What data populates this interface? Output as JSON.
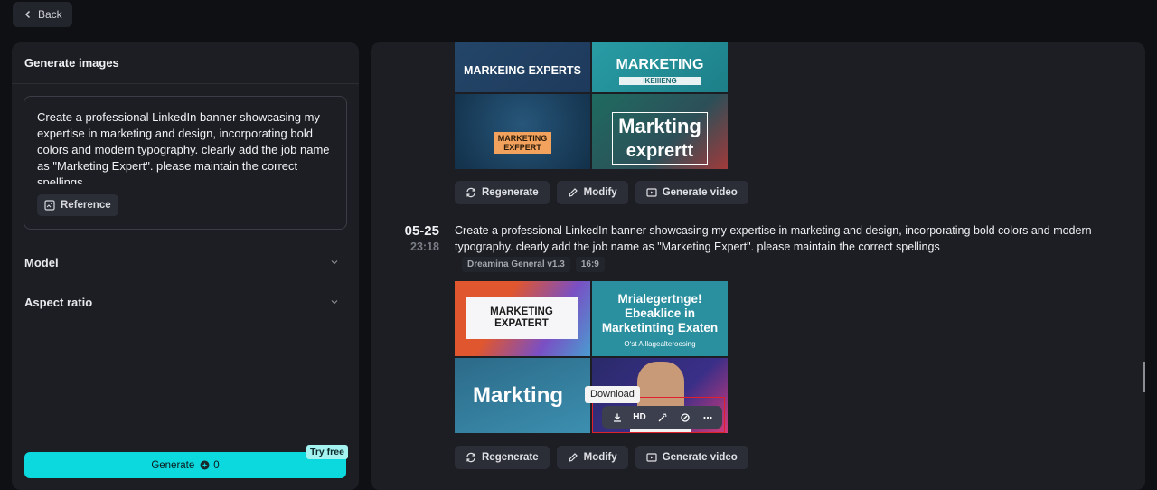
{
  "back": {
    "label": "Back"
  },
  "left": {
    "title": "Generate images",
    "prompt": "Create a professional LinkedIn banner showcasing my expertise in marketing and design, incorporating bold colors and modern typography. clearly add the job name as \"Marketing Expert\". please maintain the correct spellings",
    "reference_label": "Reference",
    "settings": [
      {
        "label": "Model",
        "icon": "chevron-down-icon"
      },
      {
        "label": "Aspect ratio",
        "icon": "chevron-down-icon"
      }
    ],
    "generate_label": "Generate",
    "credit_count": "0",
    "try_free_label": "Try free",
    "accent_color": "#0bd9de"
  },
  "feed": {
    "top_group": {
      "images": [
        {
          "lines": [
            "MARKEING EXPERTS"
          ]
        },
        {
          "lines": [
            "MARKETING",
            "IKEIIIENG"
          ]
        },
        {
          "lines": [
            "MARKETING",
            "EXFPERT"
          ]
        },
        {
          "lines": [
            "Markting",
            "exprertt"
          ]
        }
      ],
      "actions": [
        "Regenerate",
        "Modify",
        "Generate video"
      ]
    },
    "entry": {
      "date": "05-25",
      "time": "23:18",
      "prompt": "Create a professional LinkedIn banner showcasing my expertise in marketing and design, incorporating bold colors and modern typography. clearly add the job name as \"Marketing Expert\". please maintain the correct spellings",
      "tags": [
        "Dreamina General v1.3",
        "16:9"
      ],
      "images": [
        {
          "lines": [
            "MARKETING",
            "EXPATERT"
          ]
        },
        {
          "lines": [
            "Mrialegertnge!",
            "Ebeaklice in",
            "Marketinting Exaten",
            "Oʻst Aillagealteroesing"
          ]
        },
        {
          "lines": [
            "Markting"
          ]
        },
        {
          "lines": []
        }
      ],
      "tooltip": "Download",
      "hover_actions": [
        {
          "name": "download-icon",
          "label": ""
        },
        {
          "name": "hd-button",
          "label": "HD"
        },
        {
          "name": "magic-edit-icon",
          "label": ""
        },
        {
          "name": "retouch-icon",
          "label": ""
        },
        {
          "name": "more-icon",
          "label": ""
        }
      ],
      "actions": [
        "Regenerate",
        "Modify",
        "Generate video"
      ]
    }
  }
}
